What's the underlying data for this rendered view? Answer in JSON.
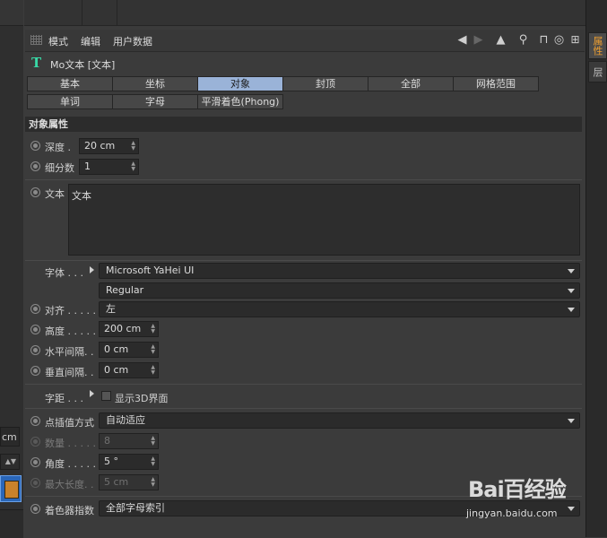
{
  "menu": {
    "items": [
      "模式",
      "编辑",
      "用户数据"
    ]
  },
  "object": {
    "title": "Mo文本 [文本]",
    "icon": "text-object-icon"
  },
  "tabs": {
    "row1": [
      "基本",
      "坐标",
      "对象",
      "封顶",
      "全部",
      "网格范围"
    ],
    "row2": [
      "单词",
      "字母",
      "平滑着色(Phong)"
    ],
    "active": "对象"
  },
  "section": {
    "title": "对象属性"
  },
  "props": {
    "depth_label": "深度 .",
    "depth_value": "20 cm",
    "subdiv_label": "细分数",
    "subdiv_value": "1",
    "text_label": "文本",
    "text_value": "文本",
    "font_label": "字体 . . .",
    "font_value": "Microsoft YaHei UI",
    "font_style": "Regular",
    "align_label": "对齐 . . . . .",
    "align_value": "左",
    "height_label": "高度 . . . . .",
    "height_value": "200 cm",
    "hspace_label": "水平间隔. .",
    "hspace_value": "0 cm",
    "vspace_label": "垂直间隔. .",
    "vspace_value": "0 cm",
    "kerning_label": "字距 . . .",
    "show3d_label": "显示3D界面",
    "interp_label": "点插值方式",
    "interp_value": "自动适应",
    "count_label": "数量 . . . . .",
    "count_value": "8",
    "angle_label": "角度 . . . . .",
    "angle_value": "5 °",
    "maxlen_label": "最大长度. .",
    "maxlen_value": "5 cm",
    "shader_label": "着色器指数",
    "shader_value": "全部字母索引"
  },
  "side_tabs": {
    "attributes": "属性",
    "layers": "层"
  },
  "left": {
    "unit": "cm"
  },
  "watermark": {
    "logo": "Bai百经验",
    "url": "jingyan.baidu.com"
  },
  "colors": {
    "accent": "#9ab3d8",
    "text_icon": "#38d9a6",
    "active_sidetab": "#f0a030"
  }
}
